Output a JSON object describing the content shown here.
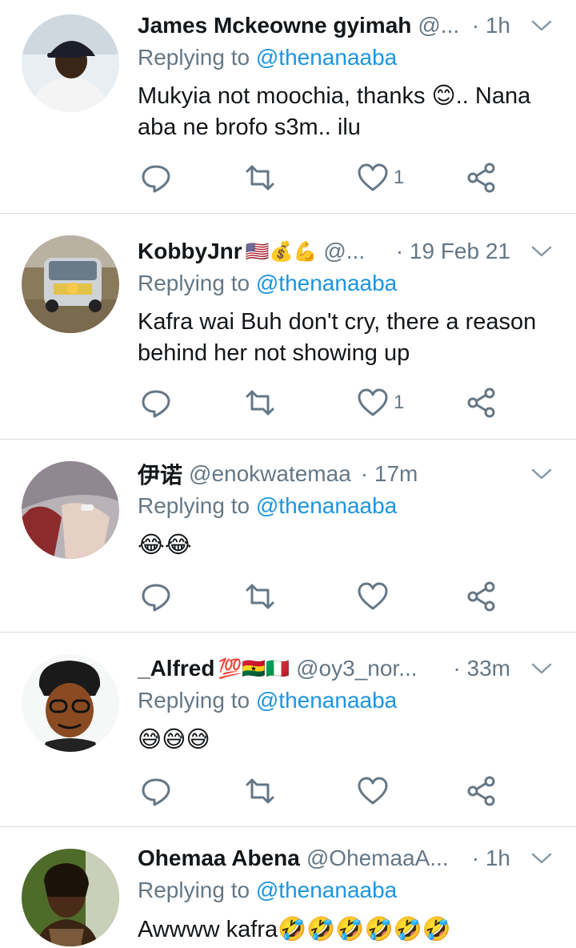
{
  "tweets": [
    {
      "name": "James Mckeowne gyimah",
      "emoji": "",
      "handle": "@...",
      "time": "· 1h",
      "replying_prefix": "Replying to ",
      "replying_to": "@thenanaaba",
      "text": "Mukyia not moochia, thanks 😊.. Nana aba ne brofo s3m.. ilu",
      "likes": "1"
    },
    {
      "name": "KobbyJnr",
      "emoji": "🇺🇸💰💪",
      "handle": "@...",
      "time": "· 19 Feb 21",
      "replying_prefix": "Replying to ",
      "replying_to": "@thenanaaba",
      "text": "Kafra wai Buh don't cry, there a reason behind her not showing up",
      "likes": "1"
    },
    {
      "name": "伊诺",
      "emoji": "",
      "handle": "@enokwatemaa",
      "time": "· 17m",
      "replying_prefix": "Replying to ",
      "replying_to": "@thenanaaba",
      "text": "😂😂",
      "likes": ""
    },
    {
      "name": "_Alfred",
      "emoji": "💯🇬🇭🇮🇹",
      "handle": "@oy3_nor...",
      "time": "· 33m",
      "replying_prefix": "Replying to ",
      "replying_to": "@thenanaaba",
      "text": "😅😅😅",
      "likes": ""
    },
    {
      "name": "Ohemaa Abena",
      "emoji": "",
      "handle": "@OhemaaA...",
      "time": "· 1h",
      "replying_prefix": "Replying to ",
      "replying_to": "@thenanaaba",
      "text": "Awwww kafra🤣🤣🤣🤣🤣🤣",
      "likes": ""
    }
  ],
  "icons": {
    "reply": "reply-icon",
    "retweet": "retweet-icon",
    "like": "heart-icon",
    "share": "share-icon",
    "more": "chevron-down-icon"
  },
  "colors": {
    "text": "#14171a",
    "muted": "#657786",
    "link": "#1b95e0",
    "divider": "#d6dbdf"
  }
}
